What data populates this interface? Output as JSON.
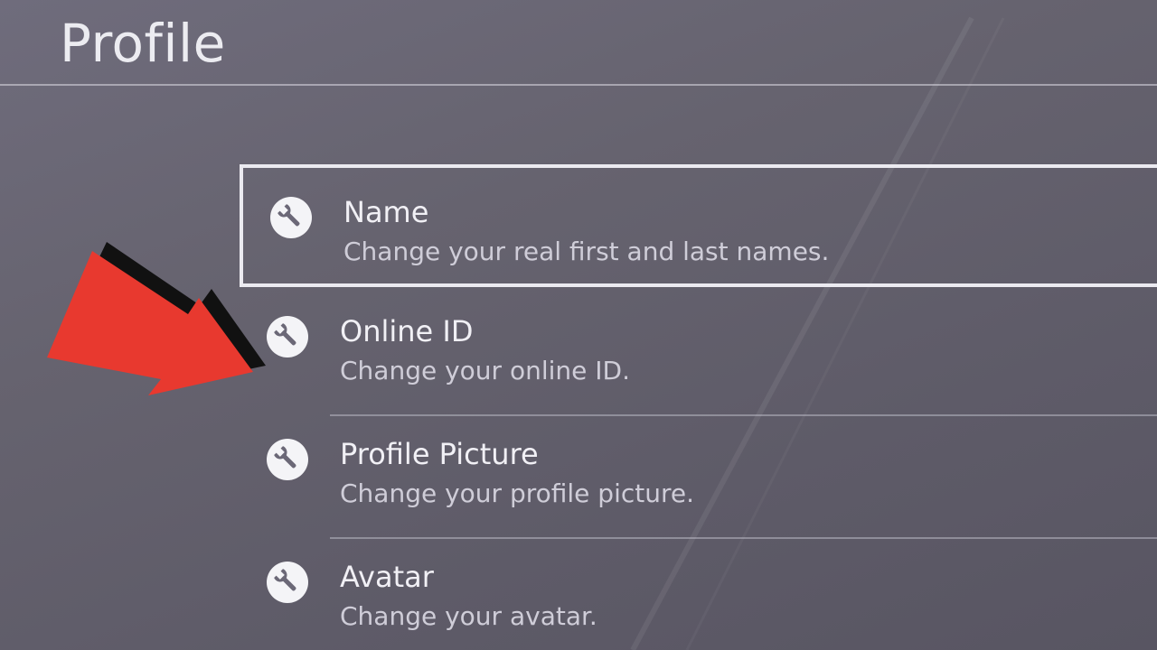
{
  "header": {
    "title": "Profile"
  },
  "menu": {
    "items": [
      {
        "title": "Name",
        "description": "Change your real first and last names.",
        "icon": "wrench-icon",
        "selected": true
      },
      {
        "title": "Online ID",
        "description": "Change your online ID.",
        "icon": "wrench-icon",
        "selected": false
      },
      {
        "title": "Profile Picture",
        "description": "Change your profile picture.",
        "icon": "wrench-icon",
        "selected": false
      },
      {
        "title": "Avatar",
        "description": "Change your avatar.",
        "icon": "wrench-icon",
        "selected": false
      }
    ]
  },
  "annotation": {
    "icon": "red-arrow-icon",
    "color": "#e8392f"
  },
  "colors": {
    "background": "#66636f",
    "text": "#f1f0f5",
    "description": "#cfcdd8",
    "selection_border": "#ebeaf0"
  }
}
